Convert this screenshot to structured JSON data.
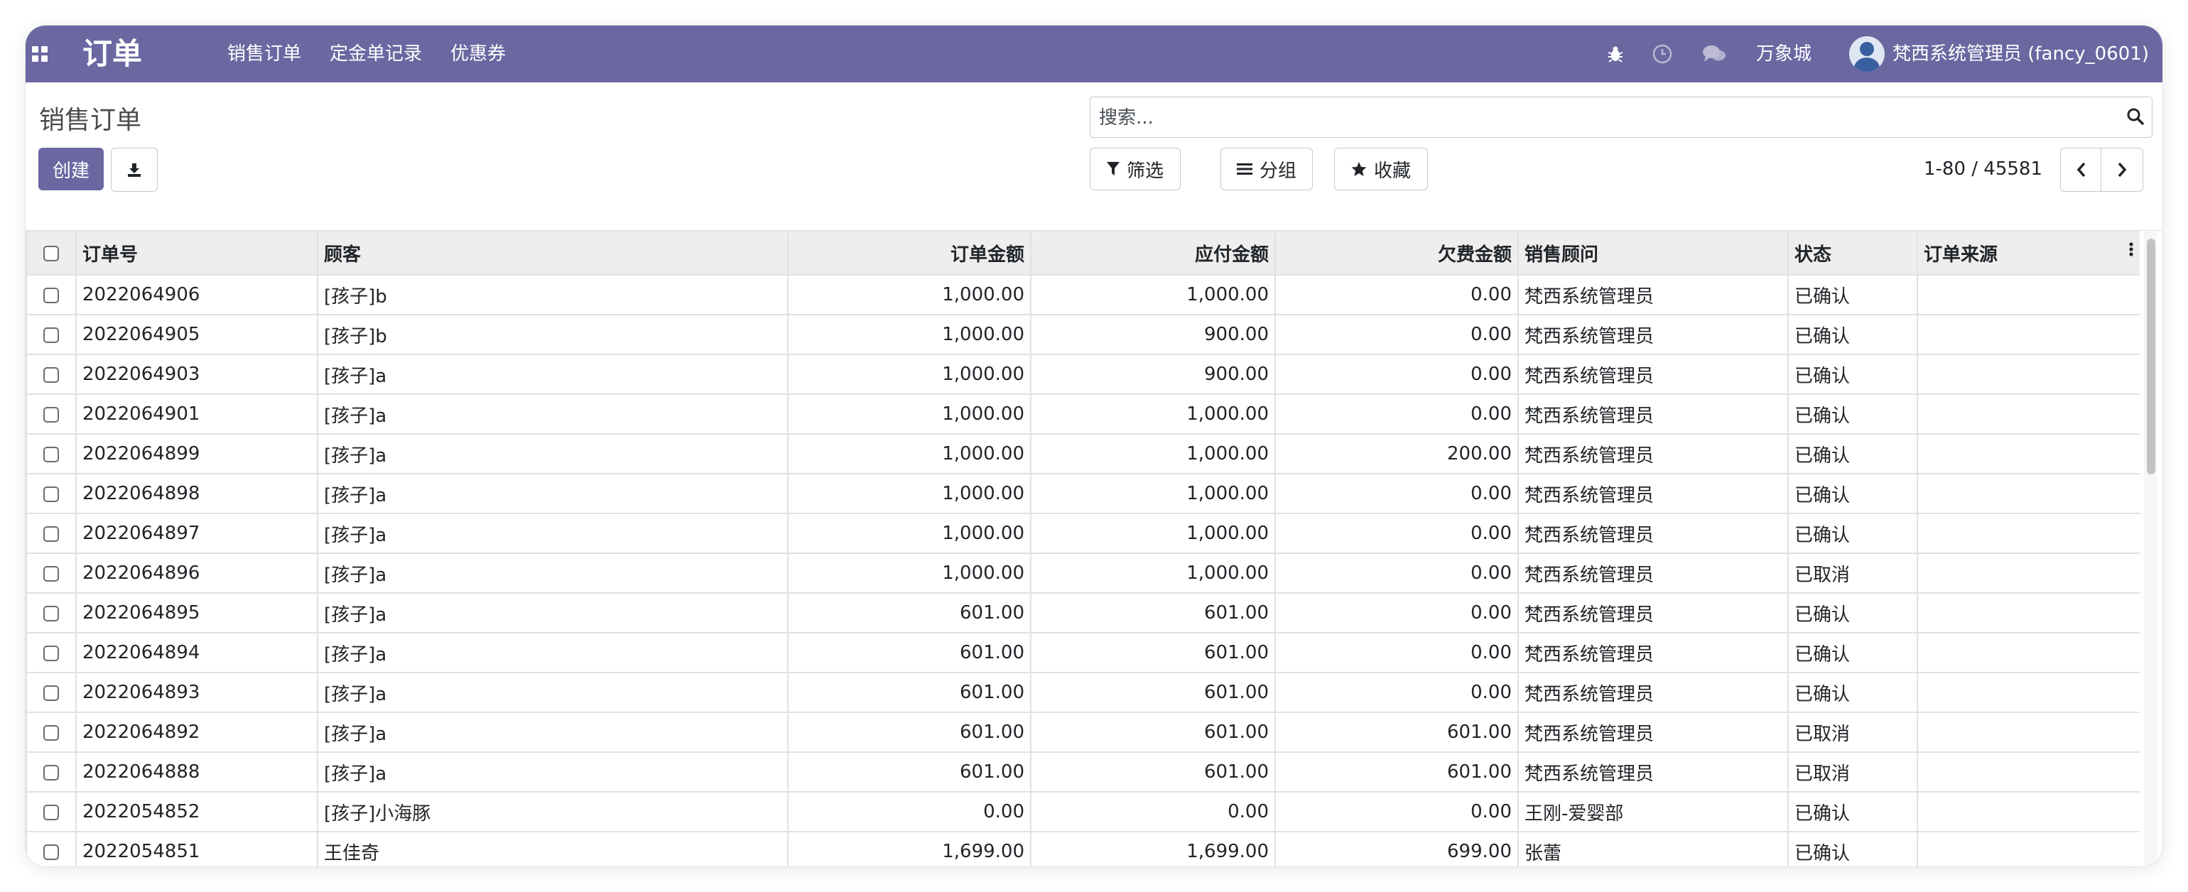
{
  "navbar": {
    "brand": "订单",
    "menu": [
      "销售订单",
      "定金单记录",
      "优惠券"
    ],
    "store": "万象城",
    "user": "梵西系统管理员 (fancy_0601)"
  },
  "control_panel": {
    "title": "销售订单",
    "create_label": "创建",
    "search_placeholder": "搜索...",
    "filter_label": "筛选",
    "group_label": "分组",
    "favorite_label": "收藏",
    "pager": "1-80 / 45581"
  },
  "table": {
    "columns": [
      "订单号",
      "顾客",
      "订单金额",
      "应付金额",
      "欠费金额",
      "销售顾问",
      "状态",
      "订单来源"
    ],
    "rows": [
      [
        "2022064906",
        "[孩子]b",
        "1,000.00",
        "1,000.00",
        "0.00",
        "梵西系统管理员",
        "已确认",
        ""
      ],
      [
        "2022064905",
        "[孩子]b",
        "1,000.00",
        "900.00",
        "0.00",
        "梵西系统管理员",
        "已确认",
        ""
      ],
      [
        "2022064903",
        "[孩子]a",
        "1,000.00",
        "900.00",
        "0.00",
        "梵西系统管理员",
        "已确认",
        ""
      ],
      [
        "2022064901",
        "[孩子]a",
        "1,000.00",
        "1,000.00",
        "0.00",
        "梵西系统管理员",
        "已确认",
        ""
      ],
      [
        "2022064899",
        "[孩子]a",
        "1,000.00",
        "1,000.00",
        "200.00",
        "梵西系统管理员",
        "已确认",
        ""
      ],
      [
        "2022064898",
        "[孩子]a",
        "1,000.00",
        "1,000.00",
        "0.00",
        "梵西系统管理员",
        "已确认",
        ""
      ],
      [
        "2022064897",
        "[孩子]a",
        "1,000.00",
        "1,000.00",
        "0.00",
        "梵西系统管理员",
        "已确认",
        ""
      ],
      [
        "2022064896",
        "[孩子]a",
        "1,000.00",
        "1,000.00",
        "0.00",
        "梵西系统管理员",
        "已取消",
        ""
      ],
      [
        "2022064895",
        "[孩子]a",
        "601.00",
        "601.00",
        "0.00",
        "梵西系统管理员",
        "已确认",
        ""
      ],
      [
        "2022064894",
        "[孩子]a",
        "601.00",
        "601.00",
        "0.00",
        "梵西系统管理员",
        "已确认",
        ""
      ],
      [
        "2022064893",
        "[孩子]a",
        "601.00",
        "601.00",
        "0.00",
        "梵西系统管理员",
        "已确认",
        ""
      ],
      [
        "2022064892",
        "[孩子]a",
        "601.00",
        "601.00",
        "601.00",
        "梵西系统管理员",
        "已取消",
        ""
      ],
      [
        "2022064888",
        "[孩子]a",
        "601.00",
        "601.00",
        "601.00",
        "梵西系统管理员",
        "已取消",
        ""
      ],
      [
        "2022054852",
        "[孩子]小海豚",
        "0.00",
        "0.00",
        "0.00",
        "王刚-爱婴部",
        "已确认",
        ""
      ],
      [
        "2022054851",
        "王佳奇",
        "1,699.00",
        "1,699.00",
        "699.00",
        "张蕾",
        "已确认",
        ""
      ]
    ]
  },
  "colors": {
    "brand": "#6b67a1"
  },
  "icons": [
    "apps-icon",
    "bug-icon",
    "clock-icon",
    "chat-icon",
    "download-icon",
    "search-icon",
    "filter-icon",
    "list-icon",
    "star-icon",
    "chevron-left-icon",
    "chevron-right-icon",
    "more-vertical-icon"
  ]
}
